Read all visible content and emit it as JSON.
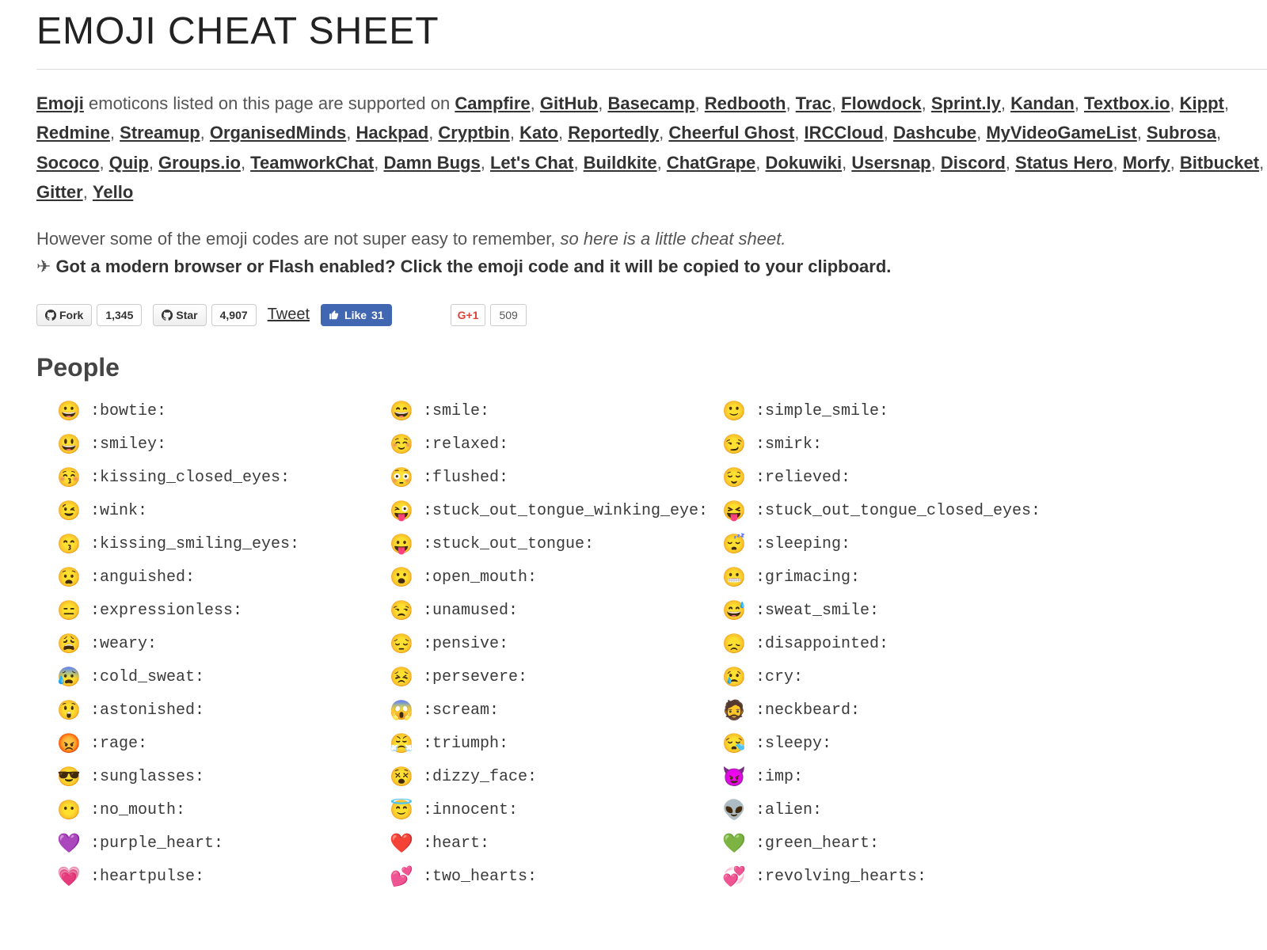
{
  "title": "EMOJI CHEAT SHEET",
  "intro_lead": "Emoji",
  "intro_tail_1": " emoticons listed on this page are supported on ",
  "services": [
    "Campfire",
    "GitHub",
    "Basecamp",
    "Redbooth",
    "Trac",
    "Flowdock",
    "Sprint.ly",
    "Kandan",
    "Textbox.io",
    "Kippt",
    "Redmine",
    "Streamup",
    "OrganisedMinds",
    "Hackpad",
    "Cryptbin",
    "Kato",
    "Reportedly",
    "Cheerful Ghost",
    "IRCCloud",
    "Dashcube",
    "MyVideoGameList",
    "Subrosa",
    "Sococo",
    "Quip",
    "Groups.io",
    "TeamworkChat",
    "Damn Bugs",
    "Let's Chat",
    "Buildkite",
    "ChatGrape",
    "Dokuwiki",
    "Usersnap",
    "Discord",
    "Status Hero",
    "Morfy",
    "Bitbucket",
    "Gitter",
    "Yello"
  ],
  "tagline_1": "However some of the emoji codes are not super easy to remember, ",
  "tagline_em": "so here is a little cheat sheet.",
  "tagline_2": "Got a modern browser or Flash enabled? Click the emoji code and it will be copied to your clipboard.",
  "buttons": {
    "fork_label": "Fork",
    "fork_count": "1,345",
    "star_label": "Star",
    "star_count": "4,907",
    "tweet_label": "Tweet",
    "like_label": "Like",
    "like_count": "31",
    "gplus_label": "+1",
    "gplus_count": "509"
  },
  "section_title": "People",
  "emojis": [
    {
      "g": "😀",
      "c": ":bowtie:"
    },
    {
      "g": "😄",
      "c": ":smile:"
    },
    {
      "g": "🙂",
      "c": ":simple_smile:"
    },
    {
      "g": "😃",
      "c": ":smiley:"
    },
    {
      "g": "☺️",
      "c": ":relaxed:"
    },
    {
      "g": "😏",
      "c": ":smirk:"
    },
    {
      "g": "😚",
      "c": ":kissing_closed_eyes:"
    },
    {
      "g": "😳",
      "c": ":flushed:"
    },
    {
      "g": "😌",
      "c": ":relieved:"
    },
    {
      "g": "😉",
      "c": ":wink:"
    },
    {
      "g": "😜",
      "c": ":stuck_out_tongue_winking_eye:"
    },
    {
      "g": "😝",
      "c": ":stuck_out_tongue_closed_eyes:"
    },
    {
      "g": "😙",
      "c": ":kissing_smiling_eyes:"
    },
    {
      "g": "😛",
      "c": ":stuck_out_tongue:"
    },
    {
      "g": "😴",
      "c": ":sleeping:"
    },
    {
      "g": "😧",
      "c": ":anguished:"
    },
    {
      "g": "😮",
      "c": ":open_mouth:"
    },
    {
      "g": "😬",
      "c": ":grimacing:"
    },
    {
      "g": "😑",
      "c": ":expressionless:"
    },
    {
      "g": "😒",
      "c": ":unamused:"
    },
    {
      "g": "😅",
      "c": ":sweat_smile:"
    },
    {
      "g": "😩",
      "c": ":weary:"
    },
    {
      "g": "😔",
      "c": ":pensive:"
    },
    {
      "g": "😞",
      "c": ":disappointed:"
    },
    {
      "g": "😰",
      "c": ":cold_sweat:"
    },
    {
      "g": "😣",
      "c": ":persevere:"
    },
    {
      "g": "😢",
      "c": ":cry:"
    },
    {
      "g": "😲",
      "c": ":astonished:"
    },
    {
      "g": "😱",
      "c": ":scream:"
    },
    {
      "g": "🧔",
      "c": ":neckbeard:"
    },
    {
      "g": "😡",
      "c": ":rage:"
    },
    {
      "g": "😤",
      "c": ":triumph:"
    },
    {
      "g": "😪",
      "c": ":sleepy:"
    },
    {
      "g": "😎",
      "c": ":sunglasses:"
    },
    {
      "g": "😵",
      "c": ":dizzy_face:"
    },
    {
      "g": "😈",
      "c": ":imp:"
    },
    {
      "g": "😶",
      "c": ":no_mouth:"
    },
    {
      "g": "😇",
      "c": ":innocent:"
    },
    {
      "g": "👽",
      "c": ":alien:"
    },
    {
      "g": "💜",
      "c": ":purple_heart:"
    },
    {
      "g": "❤️",
      "c": ":heart:"
    },
    {
      "g": "💚",
      "c": ":green_heart:"
    },
    {
      "g": "💗",
      "c": ":heartpulse:"
    },
    {
      "g": "💕",
      "c": ":two_hearts:"
    },
    {
      "g": "💞",
      "c": ":revolving_hearts:"
    }
  ]
}
